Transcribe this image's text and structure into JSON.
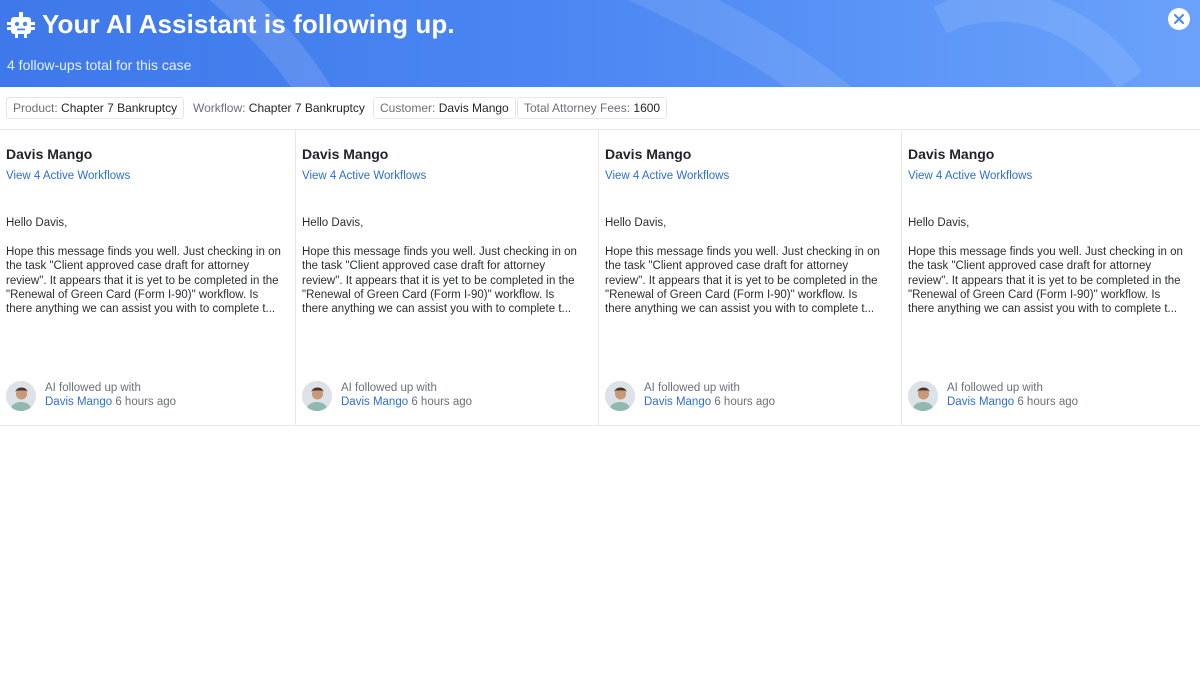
{
  "header": {
    "icon": "robot-icon",
    "title": "Your AI Assistant is following up.",
    "subtitle": "4 follow-ups total for this case",
    "close_icon": "close-icon"
  },
  "filters": [
    {
      "key": "Product:",
      "value": "Chapter 7 Bankruptcy"
    },
    {
      "key": "Workflow:",
      "value": "Chapter 7 Bankruptcy"
    },
    {
      "key": "Customer:",
      "value": "Davis Mango"
    },
    {
      "key": "Total Attorney Fees:",
      "value": "1600"
    }
  ],
  "cards": [
    {
      "name": "Davis Mango",
      "link": "View 4 Active Workflows",
      "greeting": "Hello Davis,",
      "message": "Hope this message finds you well. Just checking in on the task \"Client approved case draft for attorney review\". It appears that it is yet to be completed in the \"Renewal of Green Card (Form I-90)\" workflow. Is there anything we can assist you with to complete t...",
      "meta_prefix": "AI followed up with",
      "meta_who": "Davis Mango",
      "meta_time": "6 hours ago"
    },
    {
      "name": "Davis Mango",
      "link": "View 4 Active Workflows",
      "greeting": "Hello Davis,",
      "message": "Hope this message finds you well. Just checking in on the task \"Client approved case draft for attorney review\". It appears that it is yet to be completed in the \"Renewal of Green Card (Form I-90)\" workflow. Is there anything we can assist you with to complete t...",
      "meta_prefix": "AI followed up with",
      "meta_who": "Davis Mango",
      "meta_time": "6 hours ago"
    },
    {
      "name": "Davis Mango",
      "link": "View 4 Active Workflows",
      "greeting": "Hello Davis,",
      "message": "Hope this message finds you well. Just checking in on the task \"Client approved case draft for attorney review\". It appears that it is yet to be completed in the \"Renewal of Green Card (Form I-90)\" workflow. Is there anything we can assist you with to complete t...",
      "meta_prefix": "AI followed up with",
      "meta_who": "Davis Mango",
      "meta_time": "6 hours ago"
    },
    {
      "name": "Davis Mango",
      "link": "View 4 Active Workflows",
      "greeting": "Hello Davis,",
      "message": "Hope this message finds you well. Just checking in on the task \"Client approved case draft for attorney review\". It appears that it is yet to be completed in the \"Renewal of Green Card (Form I-90)\" workflow. Is there anything we can assist you with to complete t...",
      "meta_prefix": "AI followed up with",
      "meta_who": "Davis Mango",
      "meta_time": "6 hours ago"
    }
  ],
  "colors": {
    "header_start": "#3e78ea",
    "header_end": "#6aa2fb",
    "link": "#2c6fd6"
  }
}
